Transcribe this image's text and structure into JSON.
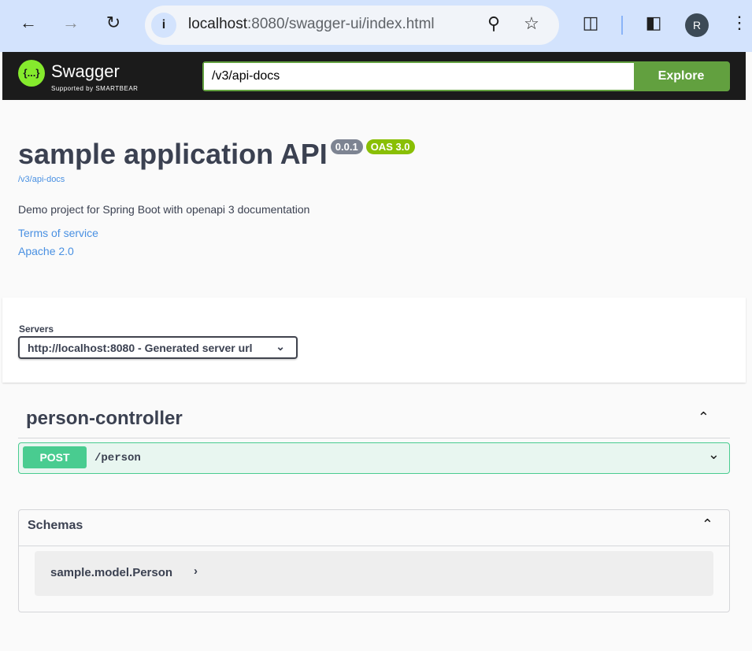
{
  "browser": {
    "url_host": "localhost",
    "url_rest": ":8080/swagger-ui/index.html",
    "profile_initial": "R"
  },
  "topbar": {
    "brand": "Swagger",
    "supported": "Supported by SMARTBEAR",
    "spec_url": "/v3/api-docs",
    "explore": "Explore",
    "logo_glyph": "{...}"
  },
  "info": {
    "title": "sample application API",
    "version": "0.0.1",
    "oas": "OAS 3.0",
    "spec_link": "/v3/api-docs",
    "description": "Demo project for Spring Boot with openapi 3 documentation",
    "terms": "Terms of service",
    "license": "Apache 2.0"
  },
  "servers": {
    "label": "Servers",
    "selected": "http://localhost:8080 - Generated server url"
  },
  "tag": {
    "name": "person-controller",
    "operations": [
      {
        "method": "POST",
        "path": "/person"
      }
    ]
  },
  "schemas": {
    "title": "Schemas",
    "models": [
      "sample.model.Person"
    ]
  },
  "colors": {
    "post": "#49cc90",
    "accent": "#62a03f",
    "oas": "#89bf04",
    "version": "#7d8492"
  }
}
